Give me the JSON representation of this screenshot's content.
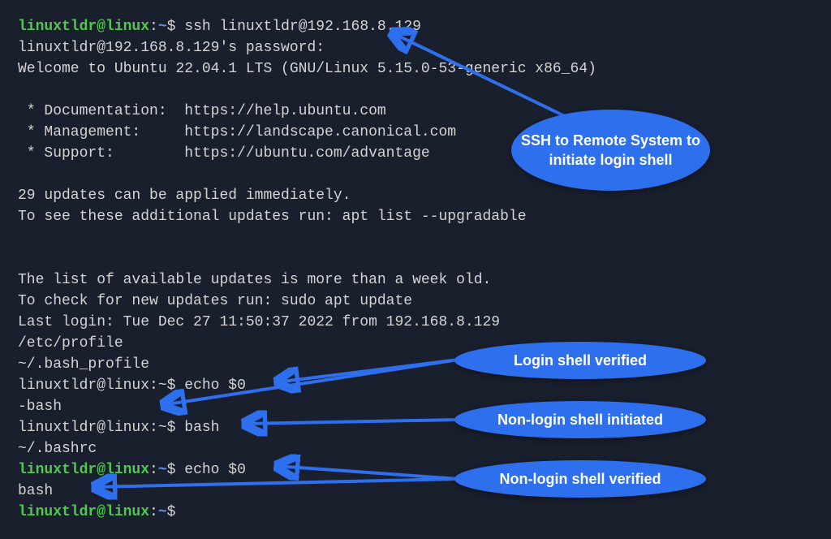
{
  "prompt": {
    "user_host": "linuxtldr@linux",
    "path": "~",
    "sep1": ":",
    "sep2": "$"
  },
  "cmd": {
    "ssh": "ssh linuxtldr@192.168.8.129",
    "echo0": "echo $0",
    "bash": "bash"
  },
  "out": {
    "pwprompt": "linuxtldr@192.168.8.129's password:",
    "welcome": "Welcome to Ubuntu 22.04.1 LTS (GNU/Linux 5.15.0-53-generic x86_64)",
    "doc": " * Documentation:  https://help.ubuntu.com",
    "mgmt": " * Management:     https://landscape.canonical.com",
    "support": " * Support:        https://ubuntu.com/advantage",
    "updates1": "29 updates can be applied immediately.",
    "updates2": "To see these additional updates run: apt list --upgradable",
    "list1": "The list of available updates is more than a week old.",
    "list2": "To check for new updates run: sudo apt update",
    "lastlogin": "Last login: Tue Dec 27 11:50:37 2022 from 192.168.8.129",
    "etcprofile": "/etc/profile",
    "bashprofile": "~/.bash_profile",
    "dashbash": "-bash",
    "bashrc": "~/.bashrc",
    "bash": "bash"
  },
  "callouts": {
    "ssh": "SSH to Remote System to initiate login shell",
    "login_verified": "Login shell verified",
    "nonlogin_init": "Non-login shell initiated",
    "nonlogin_verified": "Non-login shell verified"
  }
}
